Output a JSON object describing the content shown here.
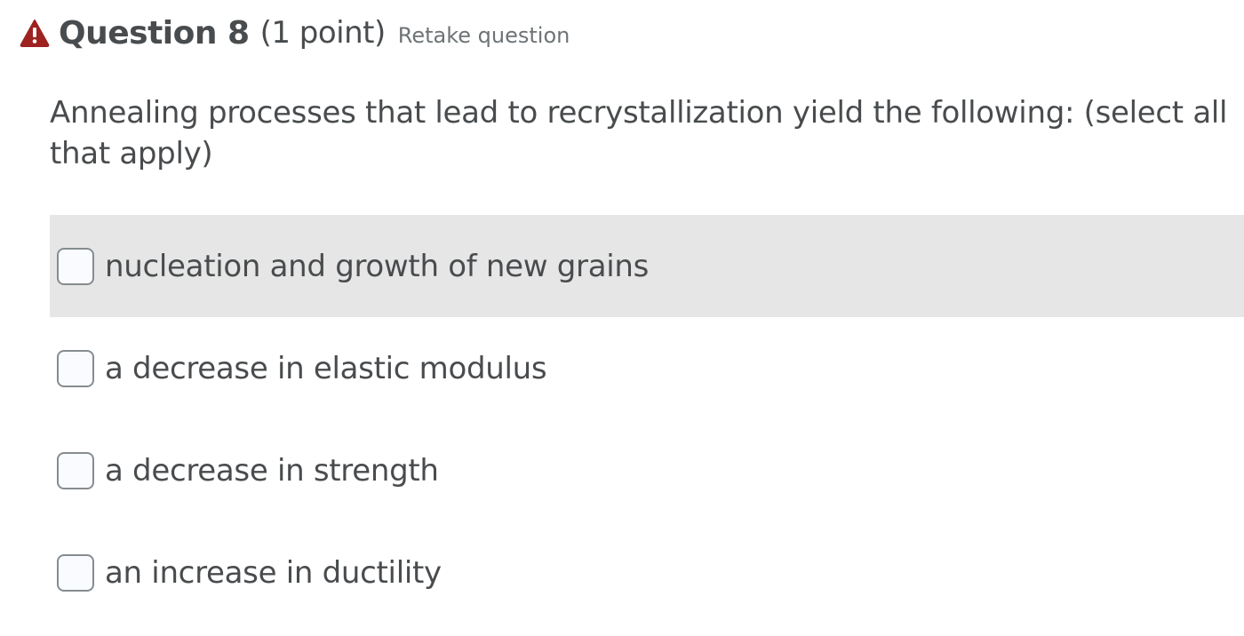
{
  "question": {
    "title": "Question 8",
    "points": "(1 point)",
    "retake_label": "Retake question",
    "status_icon": "warning-icon",
    "status_color": "#b42318",
    "prompt": "Annealing processes that lead to recrystallization yield the following: (select all that apply)"
  },
  "options": [
    {
      "label": "nucleation and growth of new grains",
      "checked": false
    },
    {
      "label": "a decrease in elastic modulus",
      "checked": false
    },
    {
      "label": "a decrease in strength",
      "checked": false
    },
    {
      "label": "an increase in ductility",
      "checked": false
    }
  ]
}
